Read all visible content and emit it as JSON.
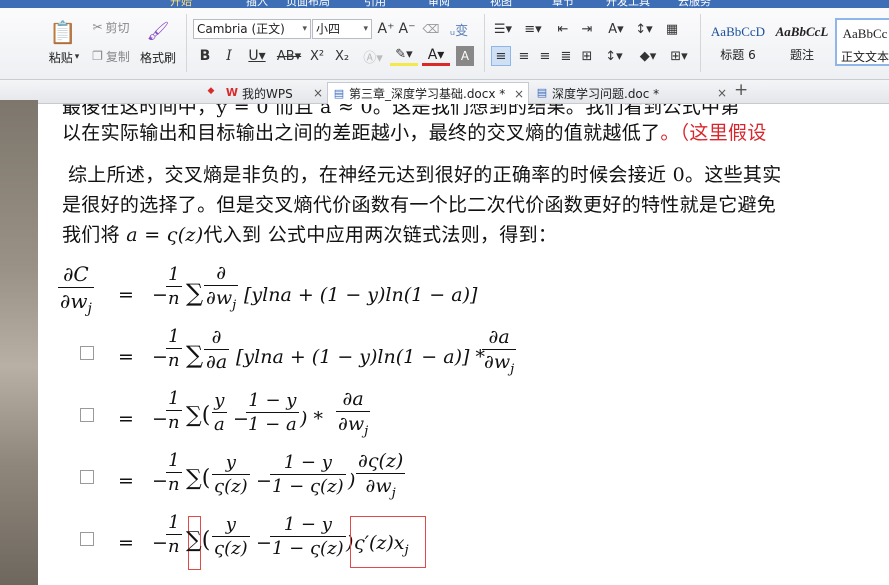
{
  "ribbon": {
    "tabs": [
      "开始",
      "插入",
      "页面布局",
      "引用",
      "审阅",
      "视图",
      "章节",
      "开发工具",
      "云服务"
    ],
    "paste_label": "粘贴",
    "cut_label": "剪切",
    "copy_label": "复制",
    "format_painter_label": "格式刷",
    "font_name": "Cambria (正文)",
    "font_size": "小四",
    "styles": [
      {
        "sample": "AaBbCcD",
        "name": "标题 6"
      },
      {
        "sample": "AaBbCcL",
        "name": "题注"
      },
      {
        "sample": "AaBbCc",
        "name": "正文文本"
      }
    ]
  },
  "tabs": [
    {
      "label": "我的WPS"
    },
    {
      "label": "第三章_深度学习基础.docx *"
    },
    {
      "label": "深度学习问题.doc *"
    }
  ],
  "document": {
    "line1_partial": "以在实际输出和目标输出之间的差距越小，最终的交叉熵的值就越低了",
    "line1_red": "。（这里假设",
    "para2_line1": "综上所述，交叉熵是非负的，在神经元达到很好的正确率的时候会接近 0。这些其实",
    "para2_line2": "是很好的选择了。但是交叉熵代价函数有一个比二次代价函数更好的特性就是它避免",
    "para2_line3_a": "我们将 ",
    "para2_line3_math": "a = ς(z)",
    "para2_line3_b": "代入到 公式中应用两次链式法则，得到："
  }
}
